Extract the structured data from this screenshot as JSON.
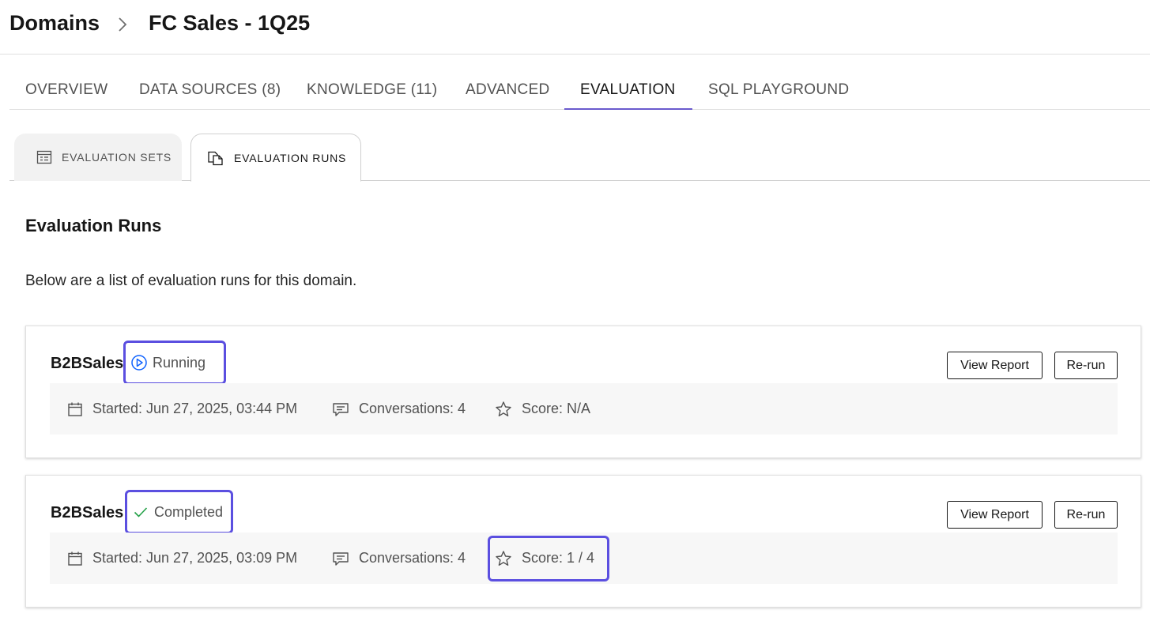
{
  "breadcrumb": {
    "root": "Domains",
    "current": "FC Sales - 1Q25"
  },
  "tabs": [
    {
      "label": "OVERVIEW"
    },
    {
      "label": "DATA SOURCES (8)"
    },
    {
      "label": "KNOWLEDGE (11)"
    },
    {
      "label": "ADVANCED"
    },
    {
      "label": "EVALUATION",
      "active": true
    },
    {
      "label": "SQL PLAYGROUND"
    }
  ],
  "subtabs": [
    {
      "label": "EVALUATION SETS",
      "icon": "table-icon"
    },
    {
      "label": "EVALUATION RUNS",
      "icon": "copy-file-icon",
      "active": true
    }
  ],
  "section": {
    "title": "Evaluation Runs",
    "description": "Below are a list of evaluation runs for this domain."
  },
  "runs": [
    {
      "name": "B2BSales",
      "status": "Running",
      "status_icon": "play-circle-icon",
      "started": "Started: Jun 27, 2025, 03:44 PM",
      "conversations": "Conversations: 4",
      "score": "Score: N/A",
      "view_report_label": "View Report",
      "rerun_label": "Re-run"
    },
    {
      "name": "B2BSales",
      "status": "Completed",
      "status_icon": "checkmark-icon",
      "started": "Started: Jun 27, 2025, 03:09 PM",
      "conversations": "Conversations: 4",
      "score": "Score: 1 / 4",
      "view_report_label": "View Report",
      "rerun_label": "Re-run"
    }
  ],
  "colors": {
    "accent": "#5b4fe0",
    "tab_underline": "#6a5acd",
    "running": "#0f62fe",
    "completed": "#24a148"
  }
}
